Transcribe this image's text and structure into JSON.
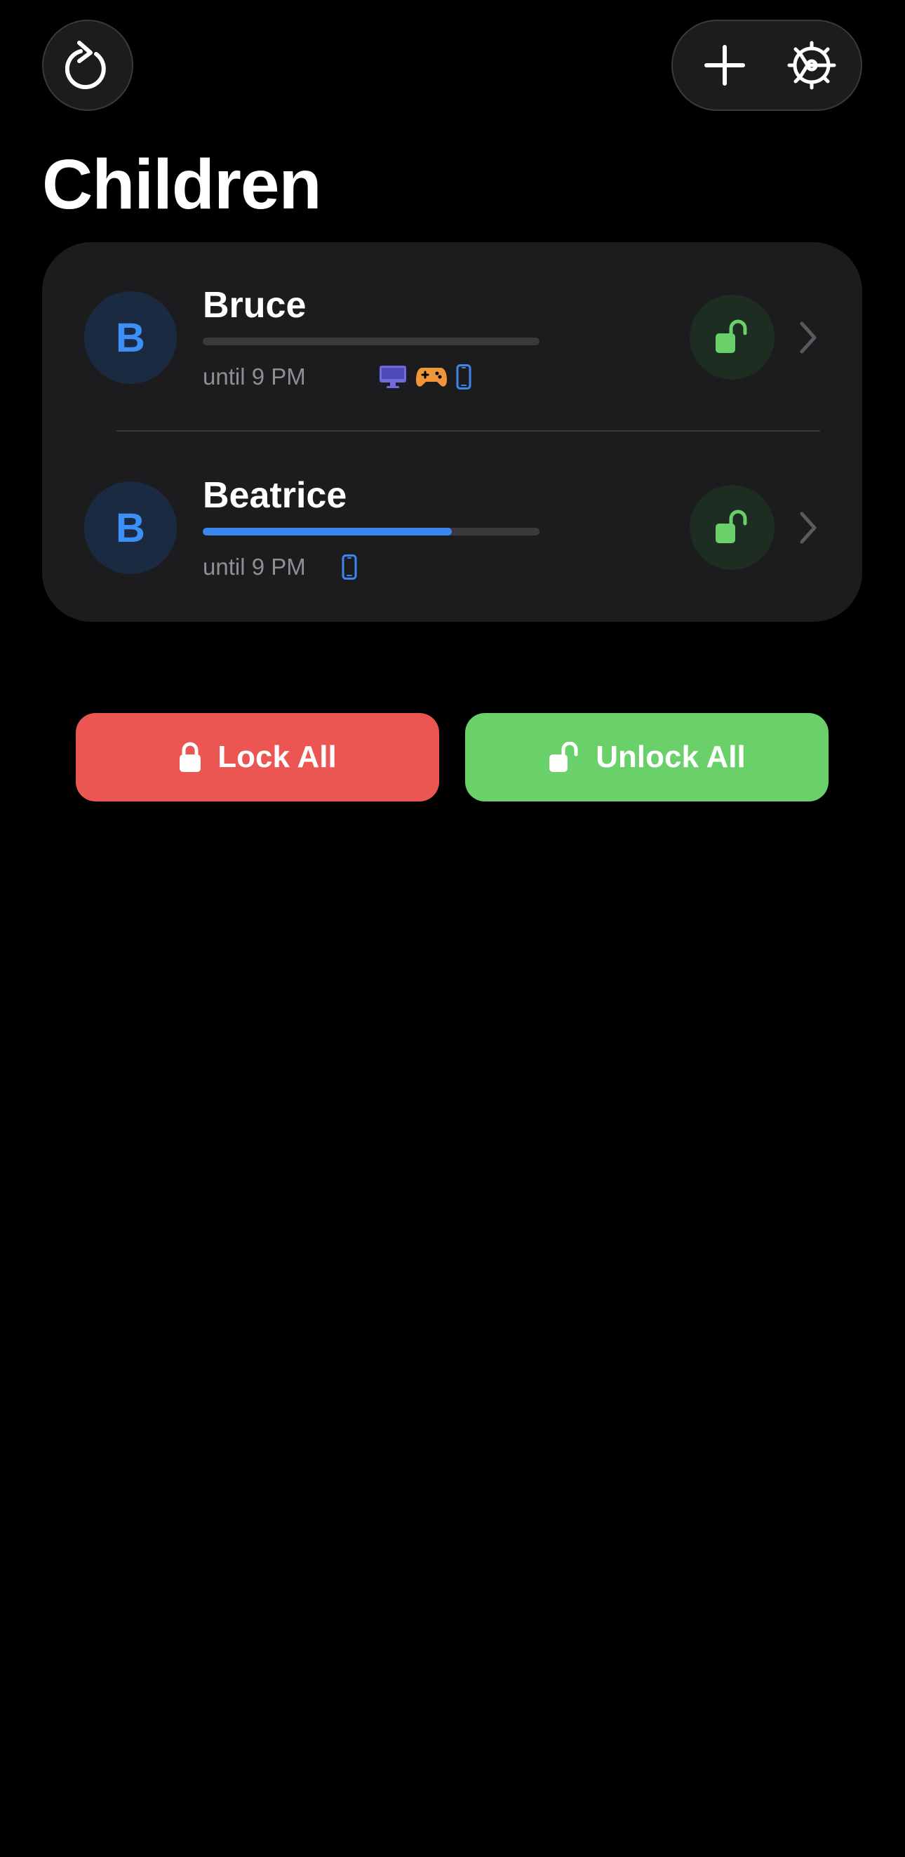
{
  "header": {
    "refresh_icon": "refresh-icon",
    "add_icon": "plus-icon",
    "settings_icon": "gear-icon",
    "title": "Children"
  },
  "children": [
    {
      "initial": "B",
      "name": "Bruce",
      "progress": 0,
      "until": "until 9 PM",
      "devices": [
        "computer-icon",
        "gamepad-icon",
        "phone-icon"
      ],
      "status": "unlocked"
    },
    {
      "initial": "B",
      "name": "Beatrice",
      "progress": 0.74,
      "until": "until 9 PM",
      "devices": [
        "phone-icon"
      ],
      "status": "unlocked"
    }
  ],
  "actions": {
    "lock_all": "Lock All",
    "unlock_all": "Unlock All"
  },
  "colors": {
    "background": "#000000",
    "card": "#1c1c1e",
    "accent_blue": "#3c86f0",
    "unlock_green": "#69d06a",
    "lock_red": "#eb5652",
    "device_purple": "#6f6ae0",
    "device_orange": "#f0953a"
  }
}
